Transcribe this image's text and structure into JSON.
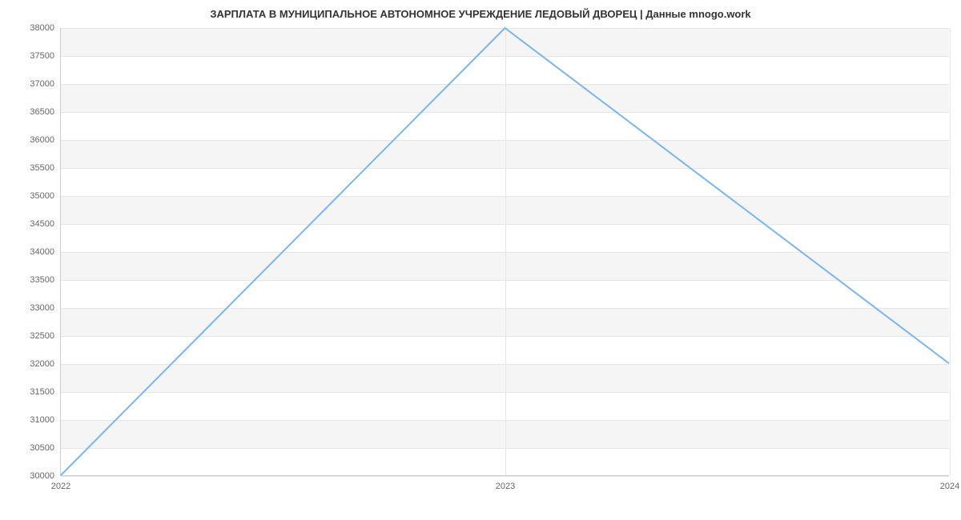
{
  "chart_data": {
    "type": "line",
    "title": "ЗАРПЛАТА В МУНИЦИПАЛЬНОЕ АВТОНОМНОЕ УЧРЕЖДЕНИЕ ЛЕДОВЫЙ ДВОРЕЦ | Данные mnogo.work",
    "x": [
      "2022",
      "2023",
      "2024"
    ],
    "values": [
      30000,
      38000,
      32000
    ],
    "xlabel": "",
    "ylabel": "",
    "ylim": [
      30000,
      38000
    ],
    "y_ticks": [
      30000,
      30500,
      31000,
      31500,
      32000,
      32500,
      33000,
      33500,
      34000,
      34500,
      35000,
      35500,
      36000,
      36500,
      37000,
      37500,
      38000
    ],
    "x_ticks": [
      "2022",
      "2023",
      "2024"
    ],
    "line_color": "#7cb5ec"
  }
}
